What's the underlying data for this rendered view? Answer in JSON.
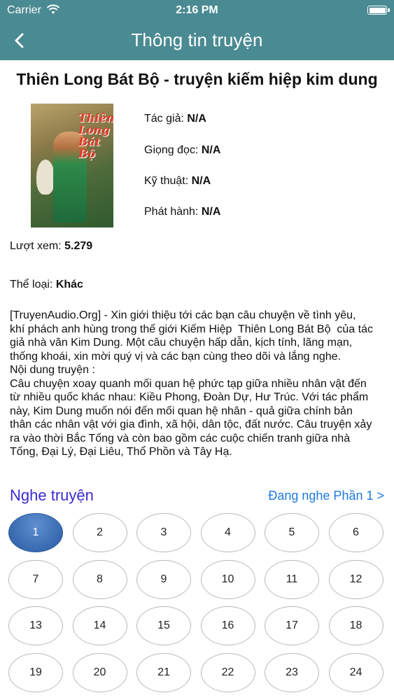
{
  "status_bar": {
    "carrier": "Carrier",
    "time": "2:16 PM",
    "wifi_icon": "wifi-icon",
    "battery_icon": "battery-icon"
  },
  "nav": {
    "title": "Thông tin truyện",
    "back_icon": "chevron-left-icon"
  },
  "book": {
    "title": "Thiên Long Bát Bộ - truyện kiếm hiệp kim dung",
    "cover_text": "Thiên Long Bát Bộ",
    "author_label": "Tác giả:",
    "author": "N/A",
    "narrator_label": "Giọng đọc:",
    "narrator": "N/A",
    "technique_label": "Kỹ thuật:",
    "technique": "N/A",
    "publisher_label": "Phát hành:",
    "publisher": "N/A",
    "views_label": "Lượt xem:",
    "views": "5.279",
    "genre_label": "Thể loại:",
    "genre": "Khác",
    "description": "[TruyenAudio.Org] - Xin giới thiệu tới các bạn câu chuyện về tình yêu, khí phách anh hùng trong thế giới Kiếm Hiệp  Thiên Long Bát Bộ  của tác giả nhà văn Kim Dung. Một câu chuyện hấp dẫn, kịch tính, lãng mạn, thống khoái, xin mời quý vị và các bạn cùng theo dõi và lắng nghe.\nNội dung truyện :\nCâu chuyện xoay quanh mối quan hệ phức tạp giữa nhiều nhân vật đến từ nhiều quốc khác nhau: Kiều Phong, Đoàn Dự, Hư Trúc. Với tác phẩm này, Kim Dung muốn nói đến mối quan hệ nhân - quả giữa chính bản thân các nhân vật với gia đình, xã hội, dân tộc, đất nước. Câu truyện xảy ra vào thời Bắc Tống và còn bao gồm các cuộc chiến tranh giữa nhà Tống, Đại Lý, Đại Liêu, Thổ Phồn và Tây Hạ."
  },
  "listen": {
    "label": "Nghe truyện",
    "current": "Đang nghe Phần 1 >",
    "active_episode": "1",
    "episodes": [
      "1",
      "2",
      "3",
      "4",
      "5",
      "6",
      "7",
      "8",
      "9",
      "10",
      "11",
      "12",
      "13",
      "14",
      "15",
      "16",
      "17",
      "18",
      "19",
      "20",
      "21",
      "22",
      "23",
      "24"
    ]
  },
  "colors": {
    "header": "#4a8a92",
    "active_episode": "#3d6fb5",
    "listen_label": "#3a2ad0",
    "link": "#1f7ae0"
  }
}
